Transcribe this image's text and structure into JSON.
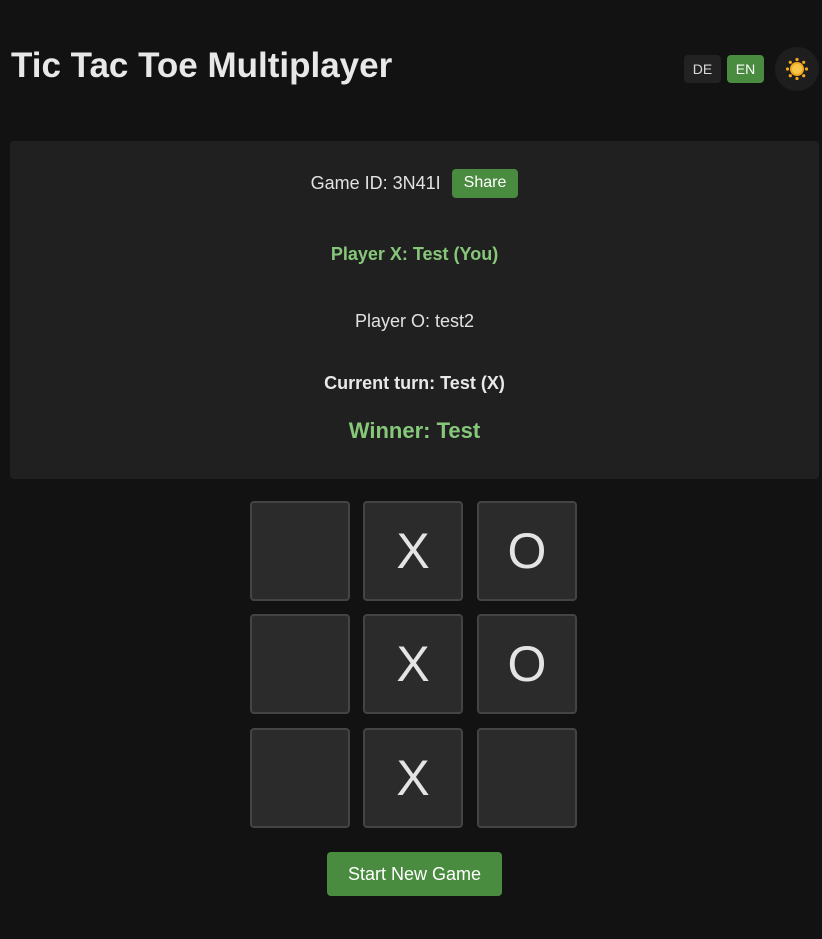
{
  "header": {
    "title": "Tic Tac Toe Multiplayer",
    "languages": {
      "de": "DE",
      "en": "EN",
      "active": "EN"
    },
    "theme_icon": "sun-icon"
  },
  "game": {
    "game_id_label": "Game ID: 3N41I",
    "share_label": "Share",
    "player_x": "Player X: Test (You)",
    "player_o": "Player O: test2",
    "current_turn": "Current turn: Test (X)",
    "winner": "Winner: Test"
  },
  "board": {
    "cells": [
      "",
      "X",
      "O",
      "",
      "X",
      "O",
      "",
      "X",
      ""
    ]
  },
  "actions": {
    "new_game_label": "Start New Game"
  },
  "colors": {
    "accent": "#4a8c3f",
    "highlight_text": "#86c77a",
    "background": "#121212",
    "panel": "#202020",
    "cell": "#2b2b2b",
    "sun": "#f2a922"
  }
}
